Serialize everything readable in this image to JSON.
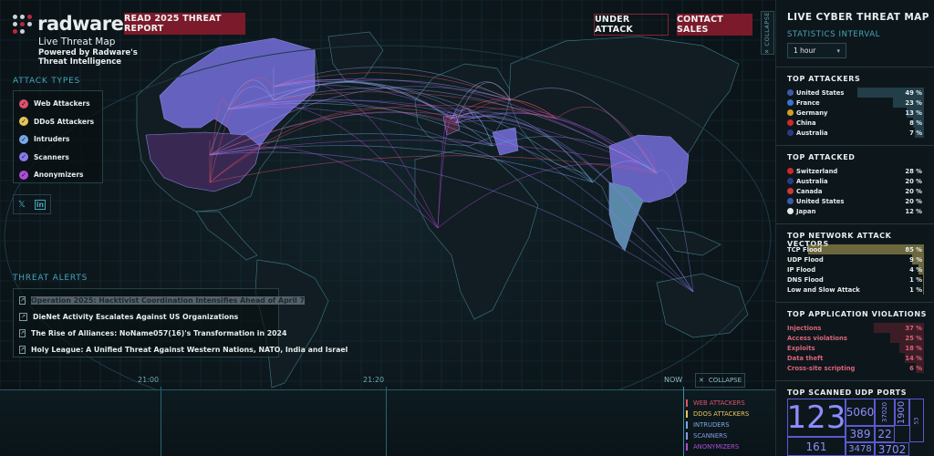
{
  "brand": {
    "logo_text": "radware",
    "subtitle": "Live Threat Map",
    "powered_line1": "Powered by Radware's",
    "powered_line2": "Threat Intelligence"
  },
  "header": {
    "report_button": "READ 2025 THREAT REPORT",
    "under_attack_button": "UNDER ATTACK",
    "contact_sales_button": "CONTACT SALES",
    "collapse_tab": "COLLAPSE"
  },
  "attack_types": {
    "title": "ATTACK TYPES",
    "items": [
      {
        "label": "Web Attackers",
        "color": "#e0506a"
      },
      {
        "label": "DDoS Attackers",
        "color": "#e8c45a"
      },
      {
        "label": "Intruders",
        "color": "#7aa8e8"
      },
      {
        "label": "Scanners",
        "color": "#8a7ae8"
      },
      {
        "label": "Anonymizers",
        "color": "#b04cd8"
      }
    ]
  },
  "social": {
    "x_icon": "𝕏",
    "linkedin_icon": "in"
  },
  "threat_alerts": {
    "title": "THREAT ALERTS",
    "items": [
      {
        "text": "Operation 2025: Hacktivist Coordination Intensifies Ahead of April 7"
      },
      {
        "text": "DieNet Activity Escalates Against US Organizations"
      },
      {
        "text": "The Rise of Alliances: NoName057(16)'s Transformation in 2024"
      },
      {
        "text": "Holy League: A Unified Threat Against Western Nations, NATO, India and Israel"
      }
    ]
  },
  "timeline": {
    "labels": [
      "21:00",
      "21:20",
      "NOW"
    ],
    "collapse_button": "COLLAPSE",
    "legend": [
      {
        "label": "WEB ATTACKERS",
        "color": "#e0506a"
      },
      {
        "label": "DDOS ATTACKERS",
        "color": "#e8c45a"
      },
      {
        "label": "INTRUDERS",
        "color": "#7aa8e8"
      },
      {
        "label": "SCANNERS",
        "color": "#8a9ae8"
      },
      {
        "label": "ANONYMIZERS",
        "color": "#b04cd8"
      }
    ]
  },
  "sidebar": {
    "title": "LIVE CYBER THREAT MAP",
    "interval_label": "STATISTICS INTERVAL",
    "interval_value": "1 hour",
    "top_attackers": {
      "title": "TOP ATTACKERS",
      "rows": [
        {
          "name": "United States",
          "pct": "49 %",
          "value": 49,
          "flag": "#3b5ba8"
        },
        {
          "name": "France",
          "pct": "23 %",
          "value": 23,
          "flag": "#3f6fd0"
        },
        {
          "name": "Germany",
          "pct": "13 %",
          "value": 13,
          "flag": "#d0a020"
        },
        {
          "name": "China",
          "pct": "8 %",
          "value": 8,
          "flag": "#d02828"
        },
        {
          "name": "Australia",
          "pct": "7 %",
          "value": 7,
          "flag": "#2a3a8a"
        }
      ]
    },
    "top_attacked": {
      "title": "TOP ATTACKED",
      "rows": [
        {
          "name": "Switzerland",
          "pct": "28 %",
          "value": 28,
          "flag": "#d02828"
        },
        {
          "name": "Australia",
          "pct": "20 %",
          "value": 20,
          "flag": "#2a3a8a"
        },
        {
          "name": "Canada",
          "pct": "20 %",
          "value": 20,
          "flag": "#d03838"
        },
        {
          "name": "United States",
          "pct": "20 %",
          "value": 20,
          "flag": "#3b5ba8"
        },
        {
          "name": "Japan",
          "pct": "12 %",
          "value": 12,
          "flag": "#e8e8e8"
        }
      ]
    },
    "network_vectors": {
      "title": "TOP NETWORK ATTACK VECTORS",
      "rows": [
        {
          "name": "TCP Flood",
          "pct": "85 %",
          "value": 85
        },
        {
          "name": "UDP Flood",
          "pct": "9 %",
          "value": 9
        },
        {
          "name": "IP Flood",
          "pct": "4 %",
          "value": 4
        },
        {
          "name": "DNS Flood",
          "pct": "1 %",
          "value": 1
        },
        {
          "name": "Low and Slow Attack",
          "pct": "1 %",
          "value": 1
        }
      ]
    },
    "app_violations": {
      "title": "TOP APPLICATION VIOLATIONS",
      "rows": [
        {
          "name": "Injections",
          "pct": "37 %",
          "value": 37
        },
        {
          "name": "Access violations",
          "pct": "25 %",
          "value": 25
        },
        {
          "name": "Exploits",
          "pct": "18 %",
          "value": 18
        },
        {
          "name": "Data theft",
          "pct": "14 %",
          "value": 14
        },
        {
          "name": "Cross-site scripting",
          "pct": "6 %",
          "value": 6
        }
      ]
    },
    "udp_ports": {
      "title": "TOP SCANNED UDP PORTS",
      "ports": [
        "123",
        "5060",
        "1900",
        "37020",
        "389",
        "22",
        "53",
        "161",
        "3478",
        "3702"
      ]
    }
  }
}
